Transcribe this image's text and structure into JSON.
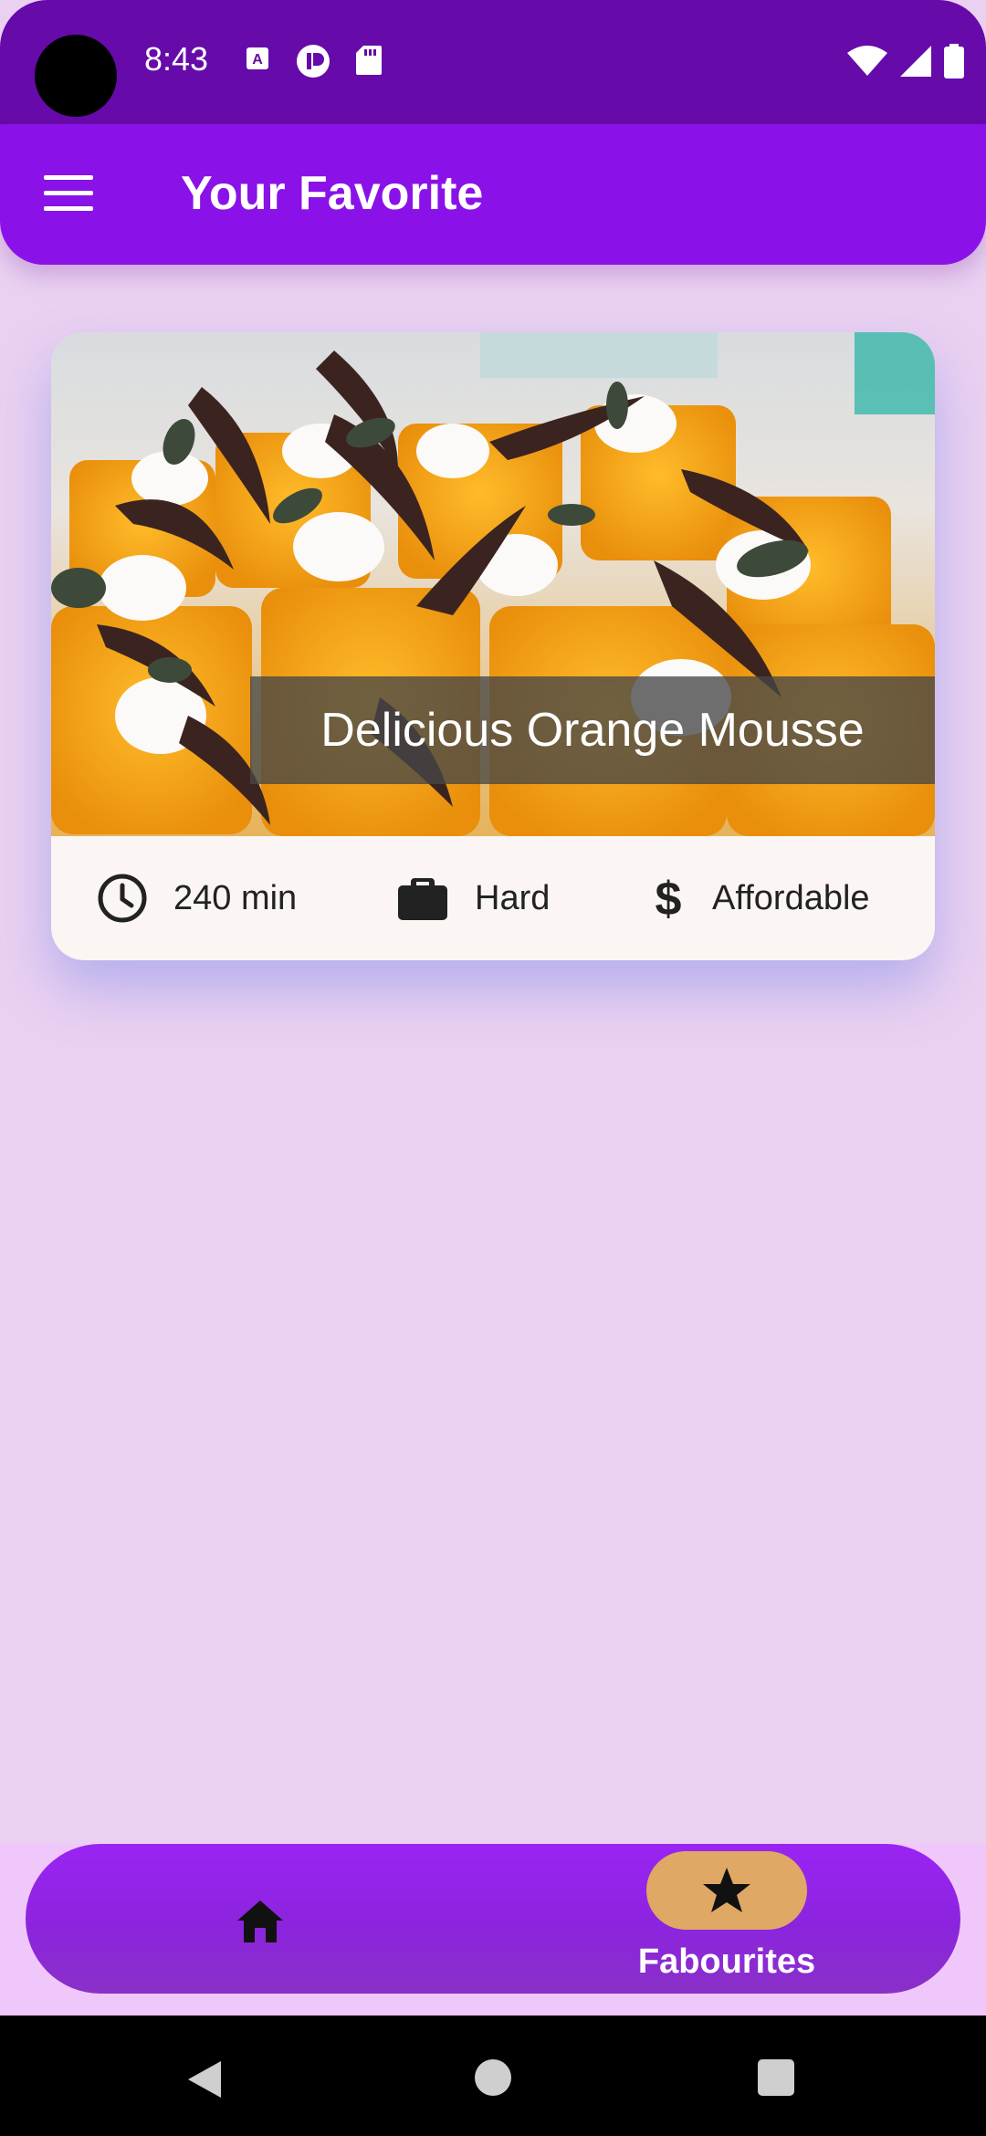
{
  "status_bar": {
    "time": "8:43"
  },
  "app_bar": {
    "title": "Your Favorite"
  },
  "recipe": {
    "title": "Delicious Orange Mousse",
    "duration": "240 min",
    "complexity": "Hard",
    "affordability": "Affordable",
    "image_icon": "orange-mousse-photo"
  },
  "bottom_nav": {
    "items": [
      {
        "icon": "home-icon",
        "label": "",
        "selected": false
      },
      {
        "icon": "star-icon",
        "label": "Fabourites",
        "selected": true
      }
    ]
  },
  "colors": {
    "status_bar": "#660aa9",
    "app_bar": "#8a12e8",
    "background": "#ead1f1",
    "nav_bar": "#9a24f3",
    "selected_pill": "#e0a865"
  }
}
